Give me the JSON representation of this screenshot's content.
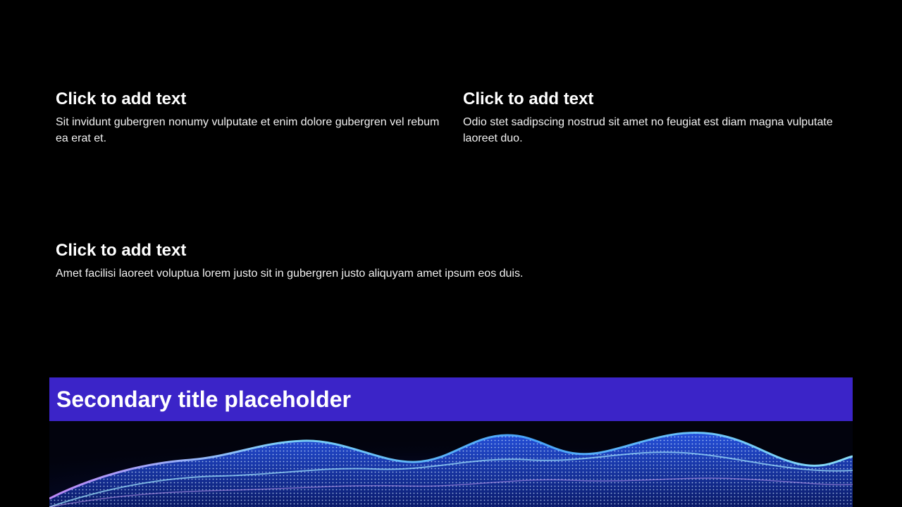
{
  "slide": {
    "blocks": [
      {
        "heading": "Click to add text",
        "body": "Sit invidunt gubergren nonumy vulputate et enim dolore gubergren vel rebum ea erat et."
      },
      {
        "heading": "Click to add text",
        "body": "Odio stet sadipscing nostrud sit amet no feugiat est diam magna vulputate laoreet duo."
      },
      {
        "heading": "Click to add text",
        "body": "Amet facilisi laoreet voluptua lorem justo sit in gubergren justo aliquyam amet ipsum eos duis."
      }
    ],
    "banner": {
      "title": "Secondary title placeholder"
    }
  },
  "colors": {
    "background": "#000000",
    "text": "#ffffff",
    "banner": "#3b24c8",
    "wave_blue": "#2f7bff",
    "wave_cyan": "#6fd3ff",
    "wave_violet": "#b07cff"
  }
}
